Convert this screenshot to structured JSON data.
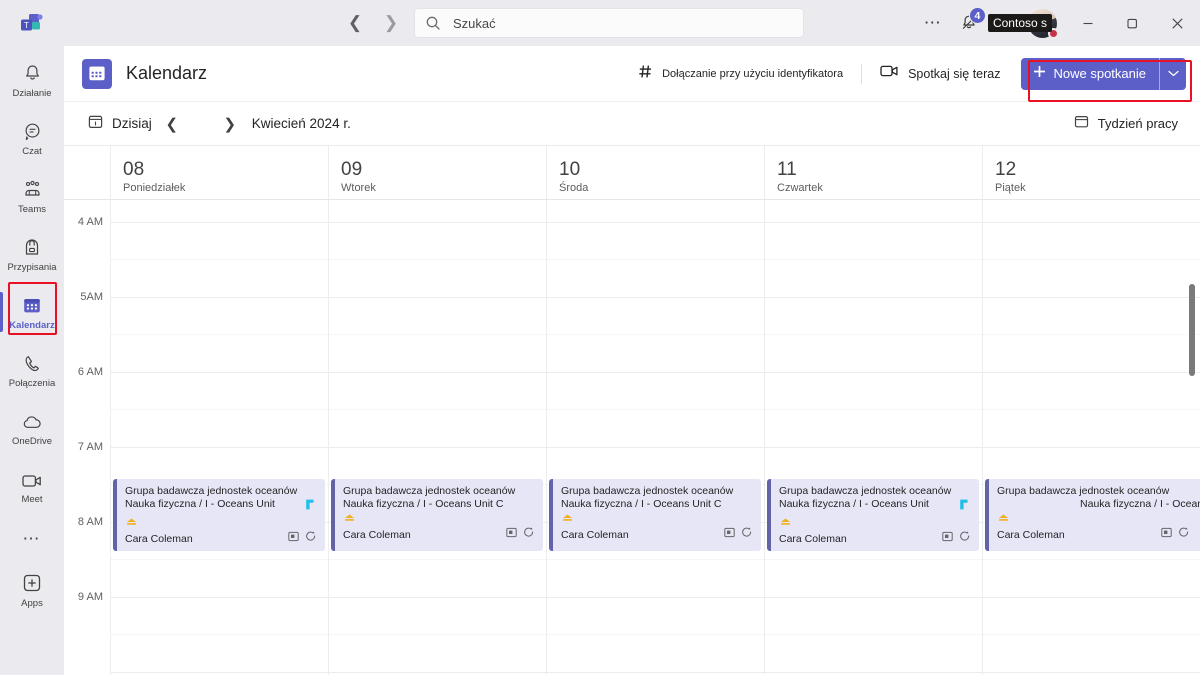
{
  "titlebar": {
    "logo_icon": "teams-logo-icon",
    "back_icon": "chevron-left-icon",
    "forward_icon": "chevron-right-icon",
    "search": {
      "placeholder": "Szukać",
      "value": "",
      "icon": "search-icon"
    },
    "more_icon": "ellipsis-icon",
    "notifications": {
      "icon": "bell-icon",
      "badge_count": "4"
    },
    "account_tooltip": "Contoso s",
    "avatar_name": "avatar",
    "presence_status_color": "#c4314b",
    "window": {
      "minimize": "minimize-icon",
      "maximize": "maximize-icon",
      "close": "close-icon"
    }
  },
  "sidebar": {
    "items": [
      {
        "label": "Działanie",
        "icon": "bell-icon",
        "active": false
      },
      {
        "label": "Czat",
        "icon": "chat-icon",
        "active": false
      },
      {
        "label": "Teams",
        "icon": "teams-people-icon",
        "active": false
      },
      {
        "label": "Przypisania",
        "icon": "backpack-icon",
        "active": false
      },
      {
        "label": "Kalendarz",
        "icon": "calendar-icon",
        "active": true
      },
      {
        "label": "Połączenia",
        "icon": "phone-icon",
        "active": false
      },
      {
        "label": "OneDrive",
        "icon": "cloud-icon",
        "active": false
      },
      {
        "label": "Meet",
        "icon": "video-camera-icon",
        "active": false
      }
    ],
    "more_icon": "ellipsis-icon",
    "apps": {
      "label": "Apps",
      "icon": "plus-square-icon"
    },
    "highlight_color": "#e81123"
  },
  "calendar_header": {
    "title": "Kalendarz",
    "title_icon": "calendar-icon",
    "join_with_id": {
      "label": "Dołączanie przy użyciu identyfikatora",
      "icon": "hash-icon"
    },
    "meet_now": {
      "label": "Spotkaj się teraz",
      "icon": "video-camera-icon"
    },
    "new_meeting": {
      "label": "Nowe spotkanie",
      "icon": "plus-icon",
      "caret_icon": "chevron-down-icon"
    },
    "highlight_color": "#e81123",
    "accent_color": "#5b5fc7"
  },
  "datebar": {
    "today": {
      "label": "Dzisiaj",
      "icon": "calendar-today-icon"
    },
    "prev_icon": "chevron-left-icon",
    "next_icon": "chevron-right-icon",
    "month_label": "Kwiecień 2024 r.",
    "view": {
      "label": "Tydzień pracy",
      "icon": "view-week-icon",
      "caret_icon": "chevron-down-icon"
    }
  },
  "days": [
    {
      "number": "08",
      "name": "Poniedziałek"
    },
    {
      "number": "09",
      "name": "Wtorek"
    },
    {
      "number": "10",
      "name": "Środa"
    },
    {
      "number": "11",
      "name": "Czwartek"
    },
    {
      "number": "12",
      "name": "Piątek"
    }
  ],
  "time_labels": [
    "4 AM",
    "5AM",
    "6 AM",
    "7 AM",
    "8 AM",
    "9 AM"
  ],
  "events": [
    {
      "day_index": 0,
      "line1": "Grupa badawcza jednostek oceanów",
      "line2": "Nauka fizyczna / I - Oceans Unit",
      "organizer": "Cara Coleman",
      "teams_icon": "teams-channel-icon",
      "has_teams_icon": true,
      "line2_align": "left",
      "overflow": false,
      "status_icon": "assignment-icon",
      "footer_icons": [
        "screen-share-icon",
        "recurrence-icon"
      ]
    },
    {
      "day_index": 1,
      "line1": "Grupa badawcza jednostek oceanów",
      "line2": "Nauka fizyczna / I - Oceans Unit C",
      "organizer": "Cara Coleman",
      "teams_icon": "teams-channel-icon",
      "has_teams_icon": false,
      "line2_align": "left",
      "overflow": false,
      "status_icon": "assignment-icon",
      "footer_icons": [
        "screen-share-icon",
        "recurrence-icon"
      ]
    },
    {
      "day_index": 2,
      "line1": "Grupa badawcza jednostek oceanów",
      "line2": "Nauka fizyczna / I - Oceans Unit C",
      "organizer": "Cara Coleman",
      "teams_icon": "teams-channel-icon",
      "has_teams_icon": false,
      "line2_align": "left",
      "overflow": false,
      "status_icon": "assignment-icon",
      "footer_icons": [
        "screen-share-icon",
        "recurrence-icon"
      ]
    },
    {
      "day_index": 3,
      "line1": "Grupa badawcza jednostek oceanów",
      "line2": "Nauka fizyczna / I - Oceans Unit",
      "organizer": "Cara Coleman",
      "teams_icon": "teams-channel-icon",
      "has_teams_icon": true,
      "line2_align": "left",
      "overflow": false,
      "status_icon": "assignment-icon",
      "footer_icons": [
        "screen-share-icon",
        "recurrence-icon"
      ]
    },
    {
      "day_index": 4,
      "line1": "Grupa badawcza jednostek oceanów",
      "line2": "Nauka fizyczna / I - Oceans Unit",
      "organizer": "Cara Coleman",
      "teams_icon": "teams-channel-icon",
      "has_teams_icon": false,
      "line2_align": "right",
      "overflow": true,
      "status_icon": "assignment-icon",
      "footer_icons": [
        "screen-share-icon",
        "recurrence-icon"
      ]
    }
  ],
  "event_style": {
    "fill": "#e6e6f7",
    "border": "#6264a7"
  },
  "scrollbar": {
    "name": "vertical-scrollbar"
  }
}
